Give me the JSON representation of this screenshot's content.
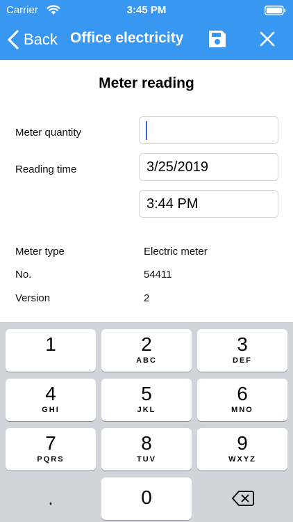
{
  "status_bar": {
    "carrier": "Carrier",
    "time": "3:45 PM"
  },
  "nav": {
    "back_label": "Back",
    "title": "Office electricity"
  },
  "form": {
    "section_title": "Meter reading",
    "quantity_label": "Meter quantity",
    "quantity_value": "",
    "reading_time_label": "Reading time",
    "reading_date": "3/25/2019",
    "reading_clock": "3:44 PM"
  },
  "info": {
    "rows": [
      {
        "label": "Meter type",
        "value": "Electric meter"
      },
      {
        "label": "No.",
        "value": "54411"
      },
      {
        "label": "Version",
        "value": "2"
      }
    ]
  },
  "keyboard": {
    "keys": [
      {
        "num": "1",
        "letters": ""
      },
      {
        "num": "2",
        "letters": "ABC"
      },
      {
        "num": "3",
        "letters": "DEF"
      },
      {
        "num": "4",
        "letters": "GHI"
      },
      {
        "num": "5",
        "letters": "JKL"
      },
      {
        "num": "6",
        "letters": "MNO"
      },
      {
        "num": "7",
        "letters": "PQRS"
      },
      {
        "num": "8",
        "letters": "TUV"
      },
      {
        "num": "9",
        "letters": "WXYZ"
      },
      {
        "num": "0",
        "letters": ""
      }
    ],
    "decimal": "."
  },
  "colors": {
    "accent": "#3897f0",
    "keyboard_bg": "#d1d4da",
    "caret": "#3b67d6"
  }
}
